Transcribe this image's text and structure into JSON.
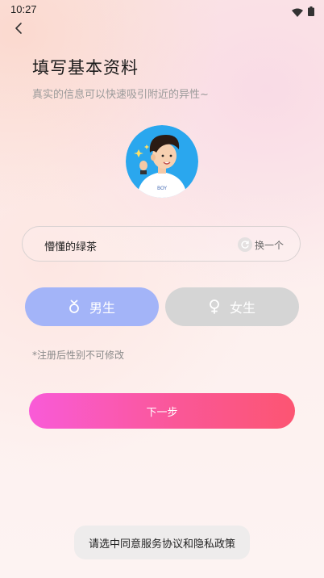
{
  "status_bar": {
    "time": "10:27"
  },
  "header": {
    "title": "填写基本资料",
    "subtitle": "真实的信息可以快速吸引附近的异性~"
  },
  "avatar": {
    "shirt_text": "BOY"
  },
  "nickname": {
    "value": "懵懂的绿茶",
    "swap_label": "换一个"
  },
  "gender": {
    "options": [
      {
        "label": "男生",
        "selected": true,
        "color": "#a3b4f8"
      },
      {
        "label": "女生",
        "selected": false,
        "color": "#d5d5d5"
      }
    ],
    "note": "*注册后性别不可修改"
  },
  "next_button": {
    "label": "下一步"
  },
  "toast": {
    "text": "请选中同意服务协议和隐私政策"
  }
}
